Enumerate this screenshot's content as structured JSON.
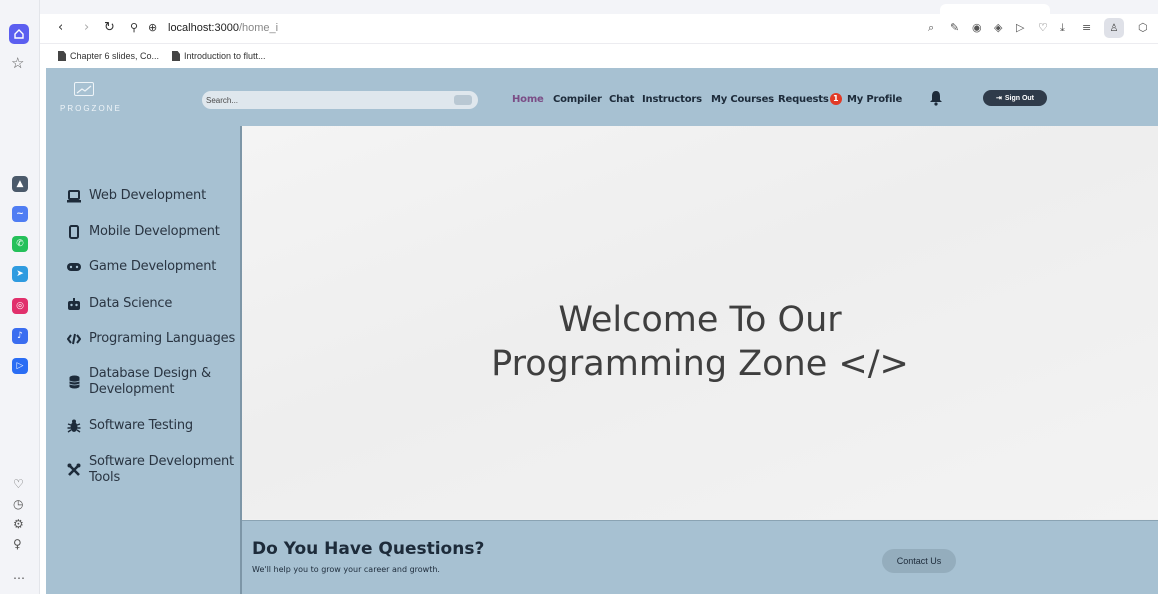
{
  "browser": {
    "url_host": "localhost:3000",
    "url_path": "/home_i",
    "bookmarks": [
      "Chapter 6 slides, Co...",
      "Introduction to flutt..."
    ]
  },
  "header": {
    "logo_text": "PROGZONE",
    "search_placeholder": "Search...",
    "nav": [
      {
        "label": "Home",
        "active": true
      },
      {
        "label": "Compiler"
      },
      {
        "label": "Chat"
      },
      {
        "label": "Instructors"
      },
      {
        "label": "My Courses"
      },
      {
        "label": "Requests",
        "badge": "1"
      },
      {
        "label": "My Profile"
      }
    ],
    "signout_label": "Sign Out"
  },
  "sidebar": {
    "items": [
      {
        "label": "Web Development",
        "icon": "laptop-icon"
      },
      {
        "label": "Mobile Development",
        "icon": "mobile-icon"
      },
      {
        "label": "Game Development",
        "icon": "gamepad-icon"
      },
      {
        "label": "Data Science",
        "icon": "robot-icon"
      },
      {
        "label": "Programing Languages",
        "icon": "code-icon"
      },
      {
        "label": "Database Design &",
        "label2": "Development",
        "icon": "database-icon"
      },
      {
        "label": "Software Testing",
        "icon": "bug-icon"
      },
      {
        "label": "Software Development",
        "label2": "Tools",
        "icon": "tools-icon"
      }
    ]
  },
  "hero": {
    "line1": "Welcome To Our",
    "line2": "Programming Zone </>"
  },
  "footer": {
    "title": "Do You Have Questions?",
    "subtitle": "We'll help you to grow your career and growth.",
    "contact_label": "Contact Us"
  },
  "colors": {
    "panel": "#a7c1d2",
    "accent": "#7b4d86",
    "badge": "#e23a26"
  }
}
